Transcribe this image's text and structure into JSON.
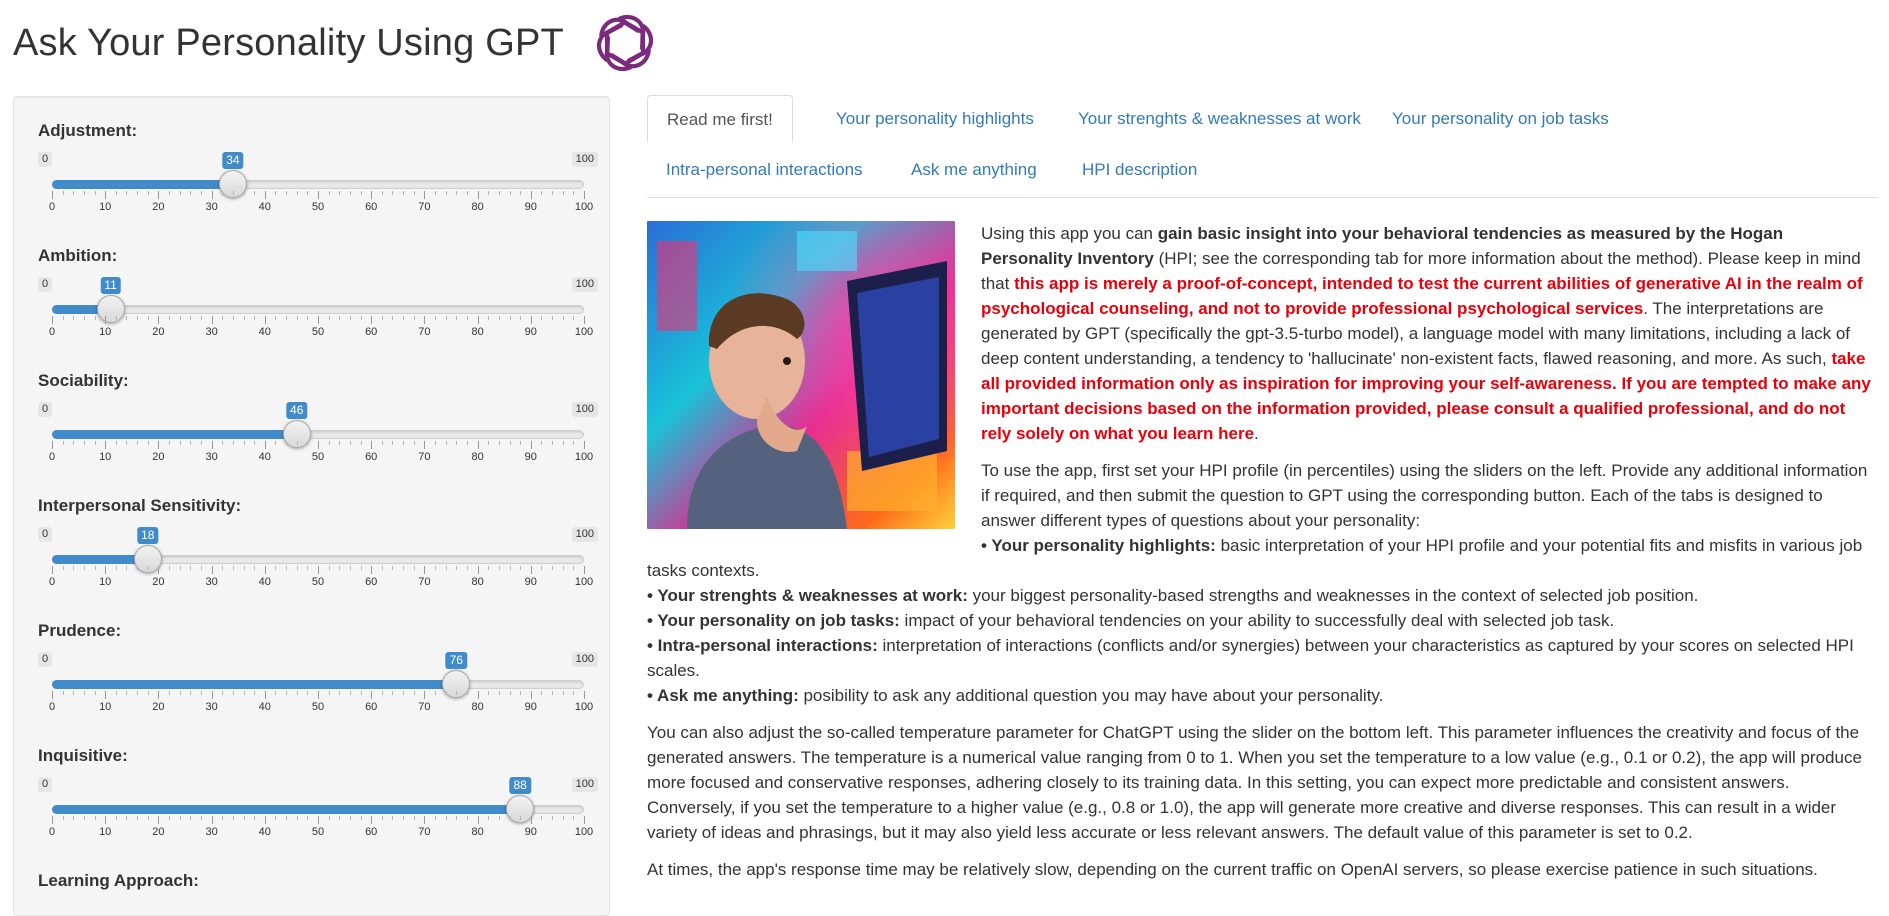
{
  "app": {
    "title": "Ask Your Personality Using GPT",
    "logo_icon": "openai-logo-icon",
    "accent_color": "#428bca"
  },
  "sliders": [
    {
      "label": "Adjustment:",
      "value": 34,
      "min": 0,
      "max": 100
    },
    {
      "label": "Ambition:",
      "value": 11,
      "min": 0,
      "max": 100
    },
    {
      "label": "Sociability:",
      "value": 46,
      "min": 0,
      "max": 100
    },
    {
      "label": "Interpersonal Sensitivity:",
      "value": 18,
      "min": 0,
      "max": 100
    },
    {
      "label": "Prudence:",
      "value": 76,
      "min": 0,
      "max": 100
    },
    {
      "label": "Inquisitive:",
      "value": 88,
      "min": 0,
      "max": 100
    },
    {
      "label": "Learning Approach:"
    }
  ],
  "tick_labels": [
    "0",
    "10",
    "20",
    "30",
    "40",
    "50",
    "60",
    "70",
    "80",
    "90",
    "100"
  ],
  "tabs": [
    {
      "label": "Read me first!",
      "active": true
    },
    {
      "label": "Your personality highlights"
    },
    {
      "label": "Your strenghts & weaknesses at work"
    },
    {
      "label": "Your personality on job tasks"
    },
    {
      "label": "Intra-personal interactions"
    },
    {
      "label": "Ask me anything"
    },
    {
      "label": "HPI description"
    }
  ],
  "content": {
    "p1_a": "Using this app you can ",
    "p1_b": "gain basic insight into your behavioral tendencies as measured by the Hogan Personality Inventory",
    "p1_c": " (HPI; see the corresponding tab for more information about the method). Please keep in mind that ",
    "p1_d": "this app is merely a proof-of-concept, intended to test the current abilities of generative AI in the realm of psychological counseling, and not to provide professional psychological services",
    "p1_e": ". The interpretations are generated by GPT (specifically the gpt-3.5-turbo model), a language model with many limitations, including a lack of deep content understanding, a tendency to 'hallucinate' non-existent facts, flawed reasoning, and more. As such, ",
    "p1_f": "take all provided information only as inspiration for improving your self-awareness. If you are tempted to make any important decisions based on the information provided, please consult a qualified professional, and do not rely solely on what you learn here",
    "p1_g": ".",
    "p2": "To use the app, first set your HPI profile (in percentiles) using the sliders on the left. Provide any additional information if required, and then submit the question to GPT using the corresponding button. Each of the tabs is designed to answer different types of questions about your personality:",
    "bullets": [
      {
        "head": "• Your personality highlights:",
        "text": " basic interpretation of your HPI profile and your potential fits and misfits in various job tasks contexts."
      },
      {
        "head": "• Your strenghts & weaknesses at work:",
        "text": " your biggest personality-based strengths and weaknesses in the context of selected job position."
      },
      {
        "head": "• Your personality on job tasks:",
        "text": " impact of your behavioral tendencies on your ability to successfully deal with selected job task."
      },
      {
        "head": "• Intra-personal interactions:",
        "text": " interpretation of interactions (conflicts and/or synergies) between your characteristics as captured by your scores on selected HPI scales."
      },
      {
        "head": "• Ask me anything:",
        "text": " posibility to ask any additional question you may have about your personality."
      }
    ],
    "p3": "You can also adjust the so-called temperature parameter for ChatGPT using the slider on the bottom left. This parameter influences the creativity and focus of the generated answers. The temperature is a numerical value ranging from 0 to 1. When you set the temperature to a low value (e.g., 0.1 or 0.2), the app will produce more focused and conservative responses, adhering closely to its training data. In this setting, you can expect more predictable and consistent answers. Conversely, if you set the temperature to a higher value (e.g., 0.8 or 1.0), the app will generate more creative and diverse responses. This can result in a wider variety of ideas and phrasings, but it may also yield less accurate or less relevant answers. The default value of this parameter is set to 0.2.",
    "p4": "At times, the app's response time may be relatively slow, depending on the current traffic on OpenAI servers, so please exercise patience in such situations.",
    "image_icon": "person-at-computer-illustration-icon"
  }
}
